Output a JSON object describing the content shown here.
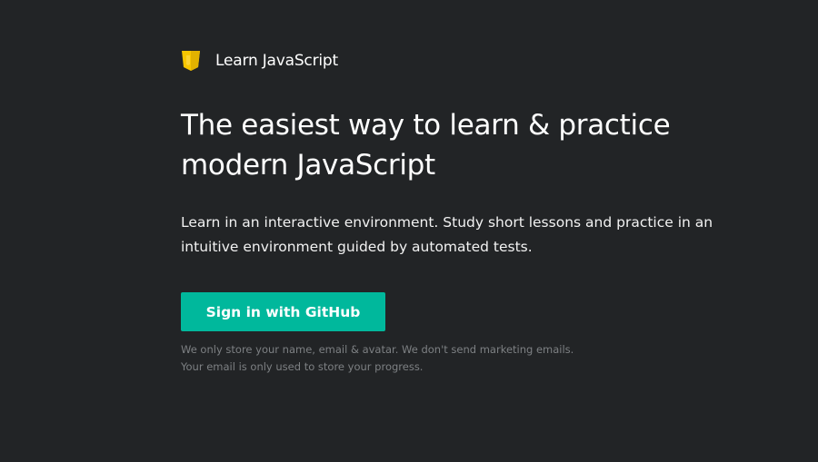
{
  "brand": {
    "title": "Learn JavaScript",
    "logo_icon": "js-shield-icon",
    "logo_color": "#f7c600"
  },
  "hero": {
    "headline_line1": "The easiest way to learn & practice",
    "headline_line2": "modern JavaScript",
    "intro_line1": "Learn in an interactive environment. Study short lessons and practice in an",
    "intro_line2": "intuitive environment guided by automated tests."
  },
  "signin": {
    "button_label": "Sign in with GitHub",
    "button_color": "#00b89c"
  },
  "privacy_note": {
    "line1": "We only store your name, email & avatar. We don't send marketing emails.",
    "line2": "Your email is only used to store your progress."
  },
  "colors": {
    "background": "#222426",
    "text": "#ffffff",
    "muted": "#7d8083"
  }
}
